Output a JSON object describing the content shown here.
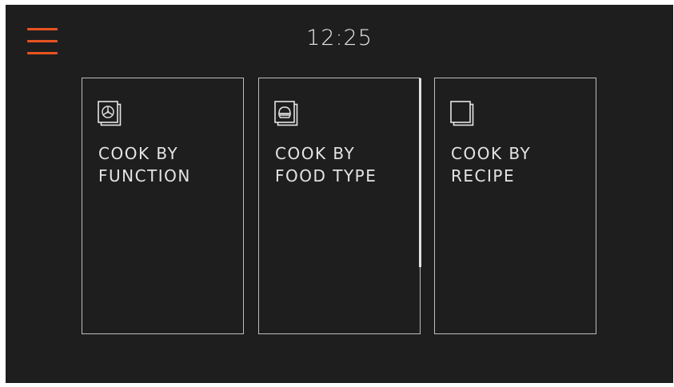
{
  "header": {
    "time": "12:25",
    "menu_icon": "hamburger-menu-icon"
  },
  "colors": {
    "accent": "#e8541f",
    "background": "#1f1e1e",
    "card_border": "#bdbdbd",
    "text": "#e4e4e4"
  },
  "cards": [
    {
      "line1": "COOK BY",
      "line2": "FUNCTION",
      "icon": "oven-fan-icon"
    },
    {
      "line1": "COOK BY",
      "line2": "FOOD TYPE",
      "icon": "food-dish-icon"
    },
    {
      "line1": "COOK BY",
      "line2": "RECIPE",
      "icon": "recipe-book-icon"
    }
  ]
}
